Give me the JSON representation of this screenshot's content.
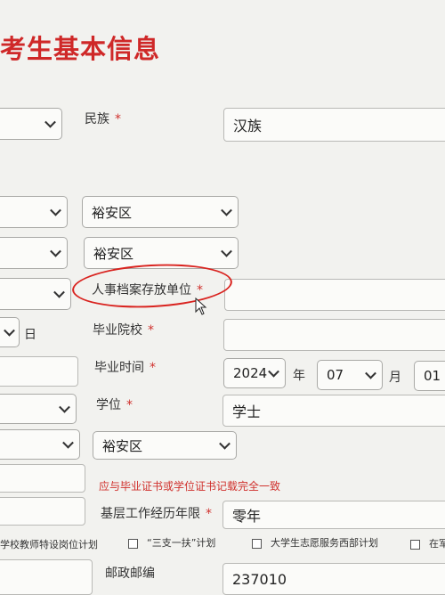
{
  "header": {
    "title": "考生基本信息"
  },
  "fields": {
    "ethnicity": {
      "label": "民族",
      "required": "*",
      "value": "汉族"
    },
    "district_1": {
      "value": "裕安区"
    },
    "district_2": {
      "value": "裕安区"
    },
    "archive_unit": {
      "label": "人事档案存放单位",
      "required": "*",
      "value": ""
    },
    "day_suffix": "日",
    "graduate_school": {
      "label": "毕业院校",
      "required": "*",
      "value": ""
    },
    "graduation_time": {
      "label": "毕业时间",
      "required": "*",
      "year": "2024",
      "year_unit": "年",
      "month": "07",
      "month_unit": "月",
      "day": "01"
    },
    "degree": {
      "label": "学位",
      "required": "*",
      "value": "学士"
    },
    "district_3": {
      "value": "裕安区"
    },
    "certificate_note": "应与毕业证书或学位证书记载完全一致",
    "grassroots_years": {
      "label": "基层工作经历年限",
      "required": "*",
      "value": "零年"
    },
    "plans": [
      "学校教师特设岗位计划",
      "“三支一扶”计划",
      "大学生志愿服务西部计划",
      "在军"
    ],
    "postal_code": {
      "label": "邮政邮编",
      "value": "237010"
    }
  }
}
